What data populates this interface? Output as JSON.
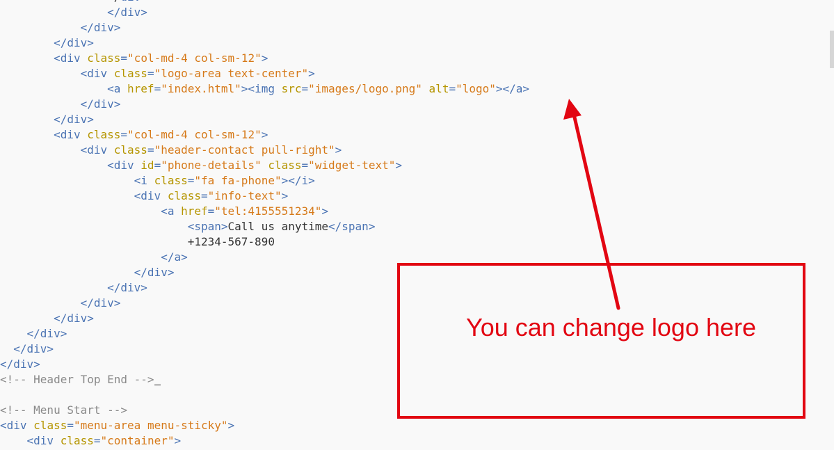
{
  "editor": {
    "lines": [
      [
        [
          "",
          "                </"
        ],
        [
          "tag",
          "div"
        ],
        [
          "",
          ">"
        ]
      ],
      [
        [
          "",
          "                "
        ],
        [
          "tag",
          "</div>"
        ]
      ],
      [
        [
          "",
          "            "
        ],
        [
          "tag",
          "</div>"
        ]
      ],
      [
        [
          "",
          "        "
        ],
        [
          "tag",
          "</div>"
        ]
      ],
      [
        [
          "",
          "        "
        ],
        [
          "tag",
          "<div "
        ],
        [
          "attr",
          "class"
        ],
        [
          "tag",
          "="
        ],
        [
          "str",
          "\"col-md-4 col-sm-12\""
        ],
        [
          "tag",
          ">"
        ]
      ],
      [
        [
          "",
          "            "
        ],
        [
          "tag",
          "<div "
        ],
        [
          "attr",
          "class"
        ],
        [
          "tag",
          "="
        ],
        [
          "str",
          "\"logo-area text-center\""
        ],
        [
          "tag",
          ">"
        ]
      ],
      [
        [
          "",
          "                "
        ],
        [
          "tag",
          "<a "
        ],
        [
          "attr",
          "href"
        ],
        [
          "tag",
          "="
        ],
        [
          "str",
          "\"index.html\""
        ],
        [
          "tag",
          "><img "
        ],
        [
          "attr",
          "src"
        ],
        [
          "tag",
          "="
        ],
        [
          "str",
          "\"images/logo.png\""
        ],
        [
          "",
          " "
        ],
        [
          "attr",
          "alt"
        ],
        [
          "tag",
          "="
        ],
        [
          "str",
          "\"logo\""
        ],
        [
          "tag",
          "></a>"
        ]
      ],
      [
        [
          "",
          "            "
        ],
        [
          "tag",
          "</div>"
        ]
      ],
      [
        [
          "",
          "        "
        ],
        [
          "tag",
          "</div>"
        ]
      ],
      [
        [
          "",
          "        "
        ],
        [
          "tag",
          "<div "
        ],
        [
          "attr",
          "class"
        ],
        [
          "tag",
          "="
        ],
        [
          "str",
          "\"col-md-4 col-sm-12\""
        ],
        [
          "tag",
          ">"
        ]
      ],
      [
        [
          "",
          "            "
        ],
        [
          "tag",
          "<div "
        ],
        [
          "attr",
          "class"
        ],
        [
          "tag",
          "="
        ],
        [
          "str",
          "\"header-contact pull-right\""
        ],
        [
          "tag",
          ">"
        ]
      ],
      [
        [
          "",
          "                "
        ],
        [
          "tag",
          "<div "
        ],
        [
          "attr",
          "id"
        ],
        [
          "tag",
          "="
        ],
        [
          "str",
          "\"phone-details\""
        ],
        [
          "",
          " "
        ],
        [
          "attr",
          "class"
        ],
        [
          "tag",
          "="
        ],
        [
          "str",
          "\"widget-text\""
        ],
        [
          "tag",
          ">"
        ]
      ],
      [
        [
          "",
          "                    "
        ],
        [
          "tag",
          "<i "
        ],
        [
          "attr",
          "class"
        ],
        [
          "tag",
          "="
        ],
        [
          "str",
          "\"fa fa-phone\""
        ],
        [
          "tag",
          "></i>"
        ]
      ],
      [
        [
          "",
          "                    "
        ],
        [
          "tag",
          "<div "
        ],
        [
          "attr",
          "class"
        ],
        [
          "tag",
          "="
        ],
        [
          "str",
          "\"info-text\""
        ],
        [
          "tag",
          ">"
        ]
      ],
      [
        [
          "",
          "                        "
        ],
        [
          "tag",
          "<a "
        ],
        [
          "attr",
          "href"
        ],
        [
          "tag",
          "="
        ],
        [
          "str",
          "\"tel:4155551234\""
        ],
        [
          "tag",
          ">"
        ]
      ],
      [
        [
          "",
          "                            "
        ],
        [
          "tag",
          "<span>"
        ],
        [
          "txt",
          "Call us anytime"
        ],
        [
          "tag",
          "</span>"
        ]
      ],
      [
        [
          "",
          "                            "
        ],
        [
          "txt",
          "+1234-567-890"
        ]
      ],
      [
        [
          "",
          "                        "
        ],
        [
          "tag",
          "</a>"
        ]
      ],
      [
        [
          "",
          "                    "
        ],
        [
          "tag",
          "</div>"
        ]
      ],
      [
        [
          "",
          "                "
        ],
        [
          "tag",
          "</div>"
        ]
      ],
      [
        [
          "",
          "            "
        ],
        [
          "tag",
          "</div>"
        ]
      ],
      [
        [
          "",
          "        "
        ],
        [
          "tag",
          "</div>"
        ]
      ],
      [
        [
          "",
          "    "
        ],
        [
          "tag",
          "</div>"
        ]
      ],
      [
        [
          "",
          "  "
        ],
        [
          "tag",
          "</div>"
        ]
      ],
      [
        [
          "",
          ""
        ],
        [
          "tag",
          "</div>"
        ]
      ],
      [
        [
          "",
          ""
        ],
        [
          "cmt",
          "<!-- Header Top End -->"
        ],
        [
          "cursor",
          ""
        ]
      ],
      [
        [
          "",
          ""
        ]
      ],
      [
        [
          "",
          ""
        ],
        [
          "cmt",
          "<!-- Menu Start -->"
        ]
      ],
      [
        [
          "",
          ""
        ],
        [
          "tag",
          "<div "
        ],
        [
          "attr",
          "class"
        ],
        [
          "tag",
          "="
        ],
        [
          "str",
          "\"menu-area menu-sticky\""
        ],
        [
          "tag",
          ">"
        ]
      ],
      [
        [
          "",
          "    "
        ],
        [
          "tag",
          "<div "
        ],
        [
          "attr",
          "class"
        ],
        [
          "tag",
          "="
        ],
        [
          "str",
          "\"container\""
        ],
        [
          "tag",
          ">"
        ]
      ]
    ]
  },
  "annotation": {
    "text": "You can change logo here",
    "color": "#e20612"
  },
  "colors": {
    "tag": "#4a73b3",
    "attr": "#b59500",
    "string": "#d67a1a",
    "text": "#333333",
    "comment": "#8a8a8a",
    "background": "#f9f9f9"
  }
}
